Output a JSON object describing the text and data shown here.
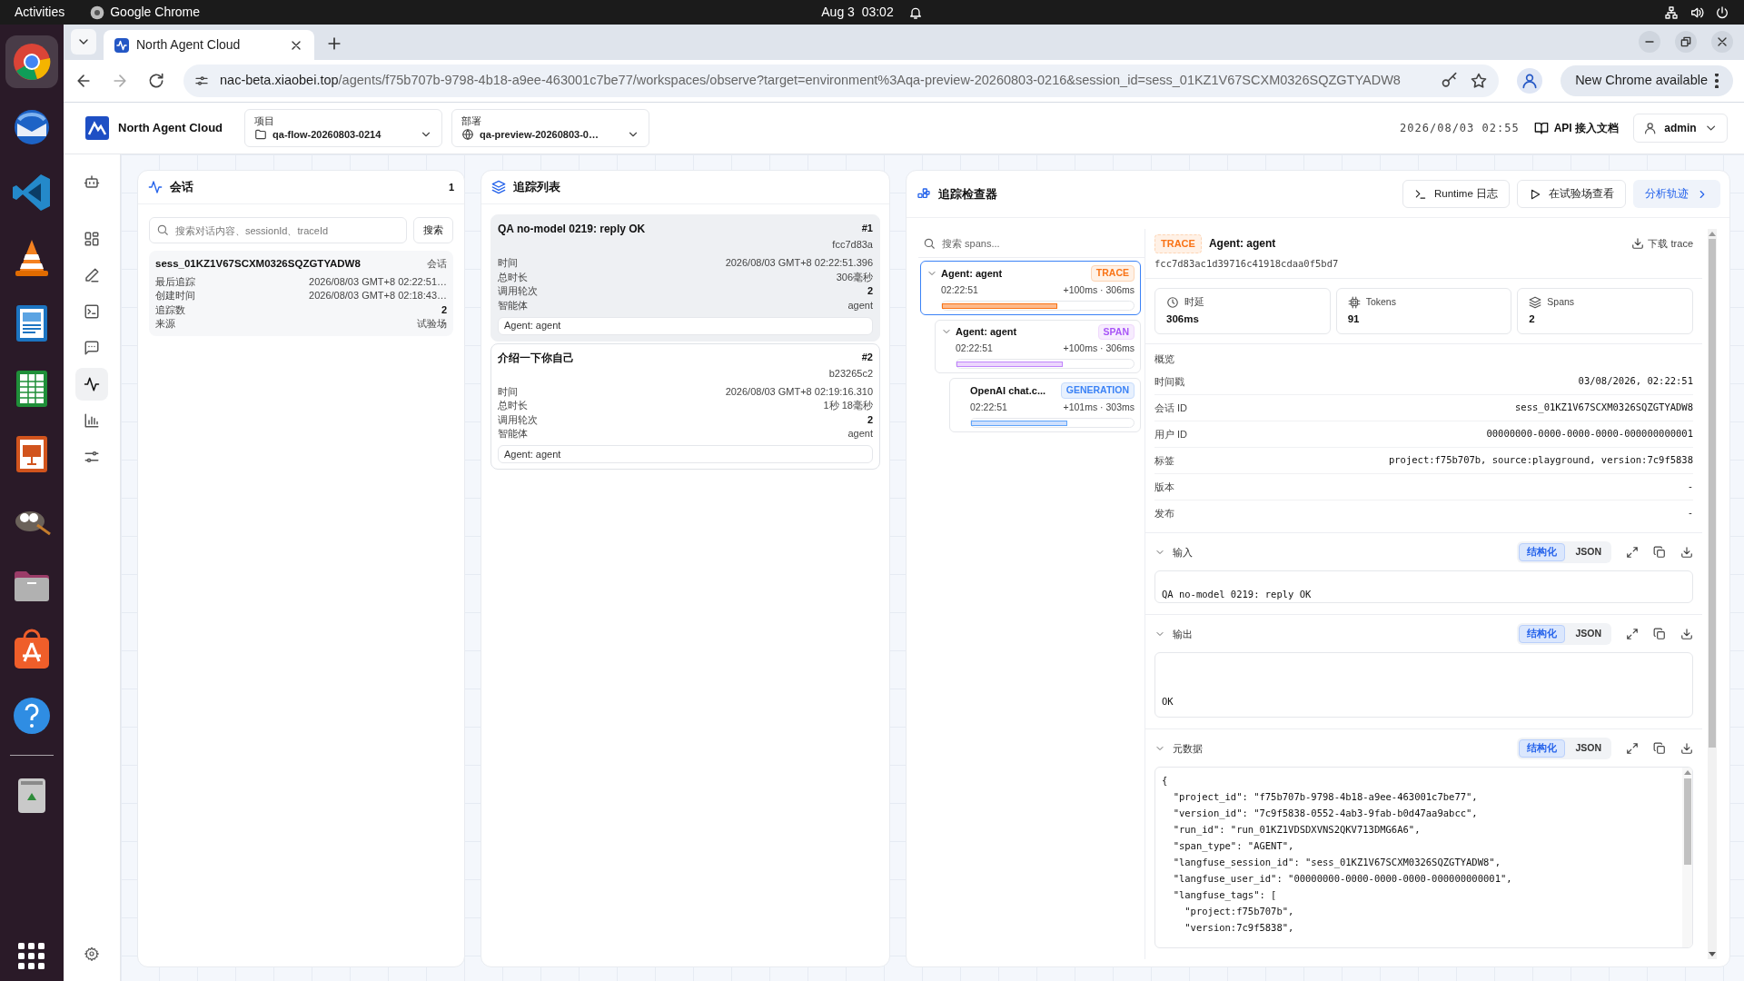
{
  "system_bar": {
    "activities": "Activities",
    "app_name": "Google Chrome",
    "clock": "Aug 3  03:02"
  },
  "dock": [
    {
      "kind": "browser",
      "selected": true
    },
    {
      "kind": "mail",
      "selected": false
    },
    {
      "kind": "code-editor",
      "selected": false
    },
    {
      "kind": "media-player",
      "selected": false
    },
    {
      "kind": "document",
      "selected": false
    },
    {
      "kind": "spreadsheet",
      "selected": false
    },
    {
      "kind": "presentation",
      "selected": false
    },
    {
      "kind": "image-editor",
      "selected": false
    },
    {
      "kind": "files",
      "selected": false
    },
    {
      "kind": "app-store",
      "selected": false
    },
    {
      "kind": "help",
      "selected": false
    },
    {
      "kind": "trash",
      "selected": false
    }
  ],
  "browser": {
    "tab_title": "North Agent Cloud",
    "url_host": "nac-beta.xiaobei.top",
    "url_path": "/agents/f75b707b-9798-4b18-a9ee-463001c7be77/workspaces/observe?target=environment%3Aqa-preview-20260803-0216&session_id=sess_01KZ1V67SCXM0326SQZGTYADW8",
    "update_button": "New Chrome available"
  },
  "app_header": {
    "brand": "North Agent Cloud",
    "project": {
      "label": "项目",
      "value": "qa-flow-20260803-0214"
    },
    "deployment": {
      "label": "部署",
      "value": "qa-preview-20260803-0…"
    },
    "datetime": "2026/08/03 02:55",
    "docs_link": "API 接入文档",
    "user": "admin"
  },
  "nav": [
    {
      "kind": "bot",
      "selected": false
    },
    {
      "kind": "grid",
      "selected": false
    },
    {
      "kind": "pencil",
      "selected": false
    },
    {
      "kind": "terminal",
      "selected": false
    },
    {
      "kind": "message",
      "selected": false
    },
    {
      "kind": "activity",
      "selected": true
    },
    {
      "kind": "chart",
      "selected": false
    },
    {
      "kind": "sliders",
      "selected": false
    }
  ],
  "sessions_panel": {
    "title": "会话",
    "count": "1",
    "search_placeholder": "搜索对话内容、sessionId、traceId",
    "search_button": "搜索",
    "sessions": [
      {
        "id": "sess_01KZ1V67SCXM0326SQZGTYADW8",
        "tag": "会话",
        "fields": [
          {
            "label": "最后追踪",
            "value": "2026/08/03 GMT+8 02:22:51…",
            "strong": false
          },
          {
            "label": "创建时间",
            "value": "2026/08/03 GMT+8 02:18:43…",
            "strong": false
          },
          {
            "label": "追踪数",
            "value": "2",
            "strong": true
          },
          {
            "label": "来源",
            "value": "试验场",
            "strong": false
          }
        ]
      }
    ]
  },
  "traces_panel": {
    "title": "追踪列表",
    "traces": [
      {
        "title": "QA no-model 0219: reply OK",
        "index": "#1",
        "short_id": "fcc7d83a",
        "selected": true,
        "agent": "Agent: agent",
        "fields": [
          {
            "label": "时间",
            "value": "2026/08/03 GMT+8 02:22:51.396",
            "strong": false
          },
          {
            "label": "总时长",
            "value": "306毫秒",
            "strong": false
          },
          {
            "label": "调用轮次",
            "value": "2",
            "strong": true
          },
          {
            "label": "智能体",
            "value": "agent",
            "strong": false
          }
        ]
      },
      {
        "title": "介绍一下你自己",
        "index": "#2",
        "short_id": "b23265c2",
        "selected": false,
        "agent": "Agent: agent",
        "fields": [
          {
            "label": "时间",
            "value": "2026/08/03 GMT+8 02:19:16.310",
            "strong": false
          },
          {
            "label": "总时长",
            "value": "1秒 18毫秒",
            "strong": false
          },
          {
            "label": "调用轮次",
            "value": "2",
            "strong": true
          },
          {
            "label": "智能体",
            "value": "agent",
            "strong": false
          }
        ]
      }
    ]
  },
  "inspector": {
    "title": "追踪检查器",
    "actions": [
      {
        "label": "Runtime 日志",
        "kind": "terminal"
      },
      {
        "label": "在试验场查看",
        "kind": "play"
      },
      {
        "label": "分析轨迹",
        "kind": "primary"
      }
    ],
    "span_search_placeholder": "搜索 spans...",
    "spans": [
      {
        "name": "Agent: agent",
        "badge": "TRACE",
        "kind": "trace",
        "time": "02:22:51",
        "timing": "+100ms · 306ms",
        "level": 0.6,
        "selected": true,
        "children": [
          {
            "name": "Agent: agent",
            "badge": "SPAN",
            "kind": "span",
            "time": "02:22:51",
            "timing": "+100ms · 306ms",
            "level": 0.6,
            "selected": false,
            "children": [
              {
                "name": "OpenAI chat.c...",
                "badge": "GENERATION",
                "kind": "generation",
                "time": "02:22:51",
                "timing": "+101ms · 303ms",
                "level": 0.59,
                "selected": false
              }
            ]
          }
        ]
      }
    ],
    "detail": {
      "badge": "TRACE",
      "kind": "trace",
      "title": "Agent: agent",
      "trace_id": "fcc7d83ac1d39716c41918cdaa0f5bd7",
      "download": "下载 trace",
      "stats": [
        {
          "kind": "clock",
          "label": "时延",
          "value": "306ms"
        },
        {
          "kind": "chip",
          "label": "Tokens",
          "value": "91"
        },
        {
          "kind": "layers",
          "label": "Spans",
          "value": "2"
        }
      ],
      "overview_title": "概览",
      "overview": [
        {
          "label": "时间戳",
          "value": "03/08/2026, 02:22:51"
        },
        {
          "label": "会话 ID",
          "value": "sess_01KZ1V67SCXM0326SQZGTYADW8"
        },
        {
          "label": "用户 ID",
          "value": "00000000-0000-0000-0000-000000000001"
        },
        {
          "label": "标签",
          "value": "project:f75b707b, source:playground, version:7c9f5838"
        },
        {
          "label": "版本",
          "value": "-"
        },
        {
          "label": "发布",
          "value": "-"
        }
      ],
      "sections": [
        {
          "title": "输入",
          "kind": "text",
          "modes": [
            {
              "label": "结构化",
              "selected": true
            },
            {
              "label": "JSON",
              "selected": false
            }
          ],
          "lines": [
            "QA no-model 0219: reply OK"
          ]
        },
        {
          "title": "输出",
          "kind": "tall-text",
          "modes": [
            {
              "label": "结构化",
              "selected": true
            },
            {
              "label": "JSON",
              "selected": false
            }
          ],
          "lines": [
            "OK"
          ]
        },
        {
          "title": "元数据",
          "kind": "code",
          "modes": [
            {
              "label": "结构化",
              "selected": true
            },
            {
              "label": "JSON",
              "selected": false
            }
          ],
          "lines": [
            "{",
            "  \"project_id\": \"f75b707b-9798-4b18-a9ee-463001c7be77\",",
            "  \"version_id\": \"7c9f5838-0552-4ab3-9fab-b0d47aa9abcc\",",
            "  \"run_id\": \"run_01KZ1VDSDXVNS2QKV713DMG6A6\",",
            "  \"span_type\": \"AGENT\",",
            "  \"langfuse_session_id\": \"sess_01KZ1V67SCXM0326SQZGTYADW8\",",
            "  \"langfuse_user_id\": \"00000000-0000-0000-0000-000000000001\",",
            "  \"langfuse_tags\": [",
            "    \"project:f75b707b\",",
            "    \"version:7c9f5838\","
          ]
        }
      ]
    }
  }
}
